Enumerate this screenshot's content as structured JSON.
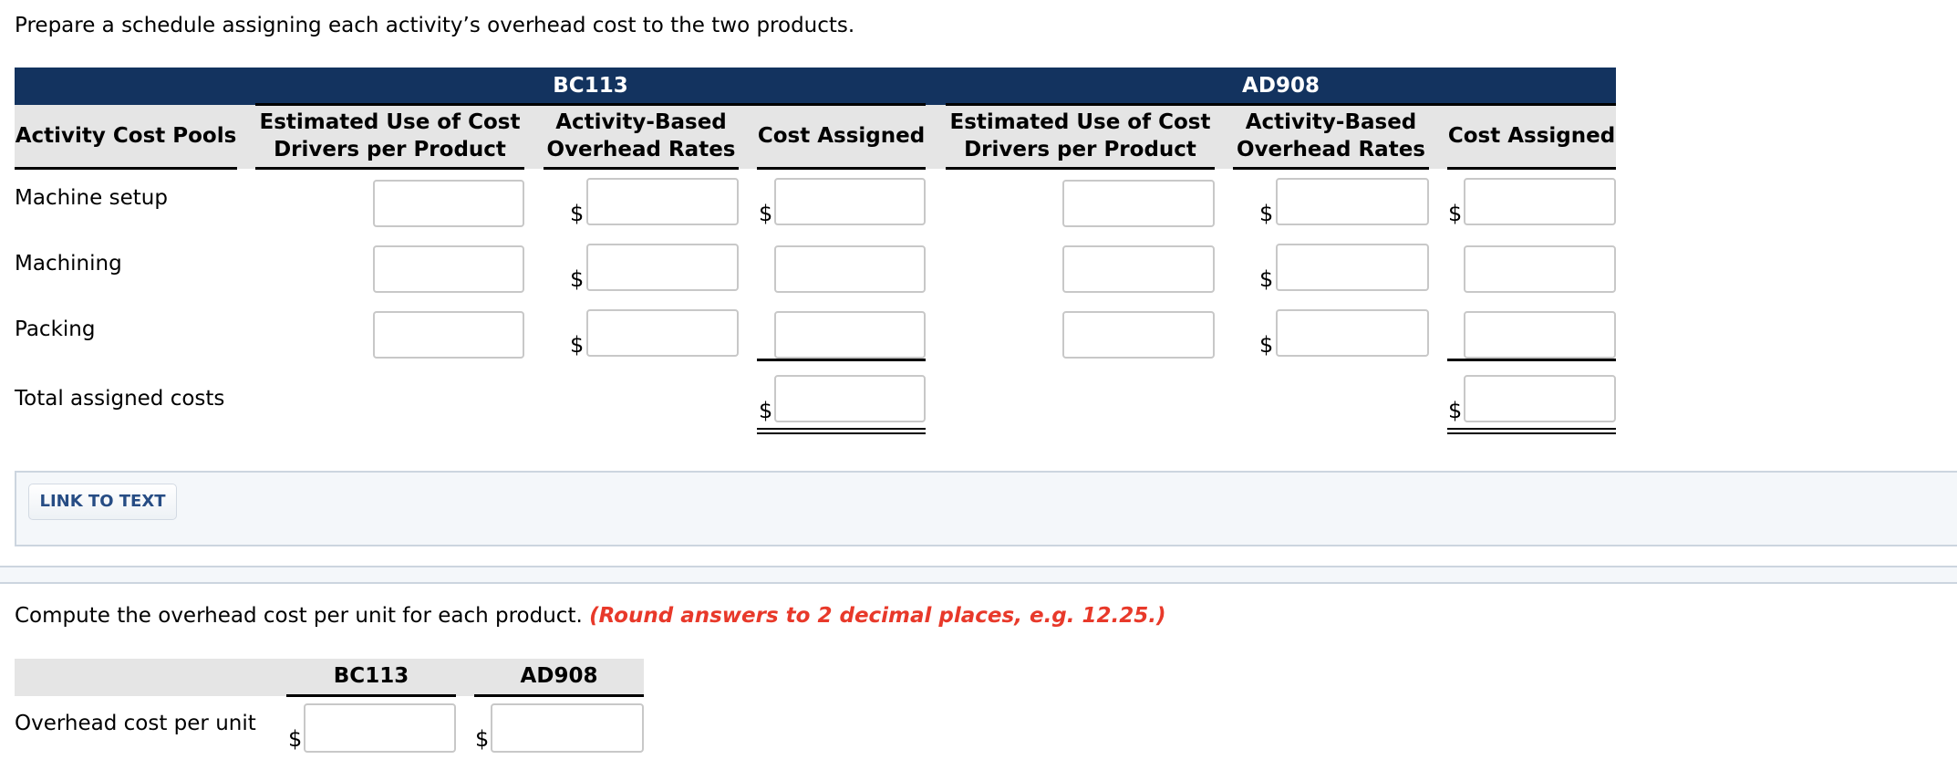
{
  "instruction": "Prepare a schedule assigning each activity’s overhead cost to the two products.",
  "schedule": {
    "groups": [
      {
        "label": "BC113"
      },
      {
        "label": "AD908"
      }
    ],
    "columns": {
      "pools": "Activity Cost Pools",
      "est_use": "Estimated Use of Cost Drivers per Product",
      "rates": "Activity-Based Overhead Rates",
      "cost": "Cost Assigned"
    },
    "rows": [
      {
        "label": "Machine setup",
        "bc113": {
          "est_use": "",
          "rate": "",
          "cost": ""
        },
        "ad908": {
          "est_use": "",
          "rate": "",
          "cost": ""
        }
      },
      {
        "label": "Machining",
        "bc113": {
          "est_use": "",
          "rate": "",
          "cost": ""
        },
        "ad908": {
          "est_use": "",
          "rate": "",
          "cost": ""
        }
      },
      {
        "label": "Packing",
        "bc113": {
          "est_use": "",
          "rate": "",
          "cost": ""
        },
        "ad908": {
          "est_use": "",
          "rate": "",
          "cost": ""
        }
      }
    ],
    "total": {
      "label": "Total assigned costs",
      "bc113": "",
      "ad908": ""
    },
    "currency_symbol": "$"
  },
  "link_to_text": "LINK TO TEXT",
  "compute": {
    "text": "Compute the overhead cost per unit for each product.",
    "note": "(Round answers to 2 decimal places, e.g. 12.25.)",
    "note_color": "#e8392a",
    "columns": [
      "BC113",
      "AD908"
    ],
    "row_label": "Overhead cost per unit",
    "values": {
      "bc113": "",
      "ad908": ""
    }
  },
  "colors": {
    "header_navy": "#13335f",
    "header_gray": "#e5e5e5",
    "link_text": "#264c84"
  }
}
